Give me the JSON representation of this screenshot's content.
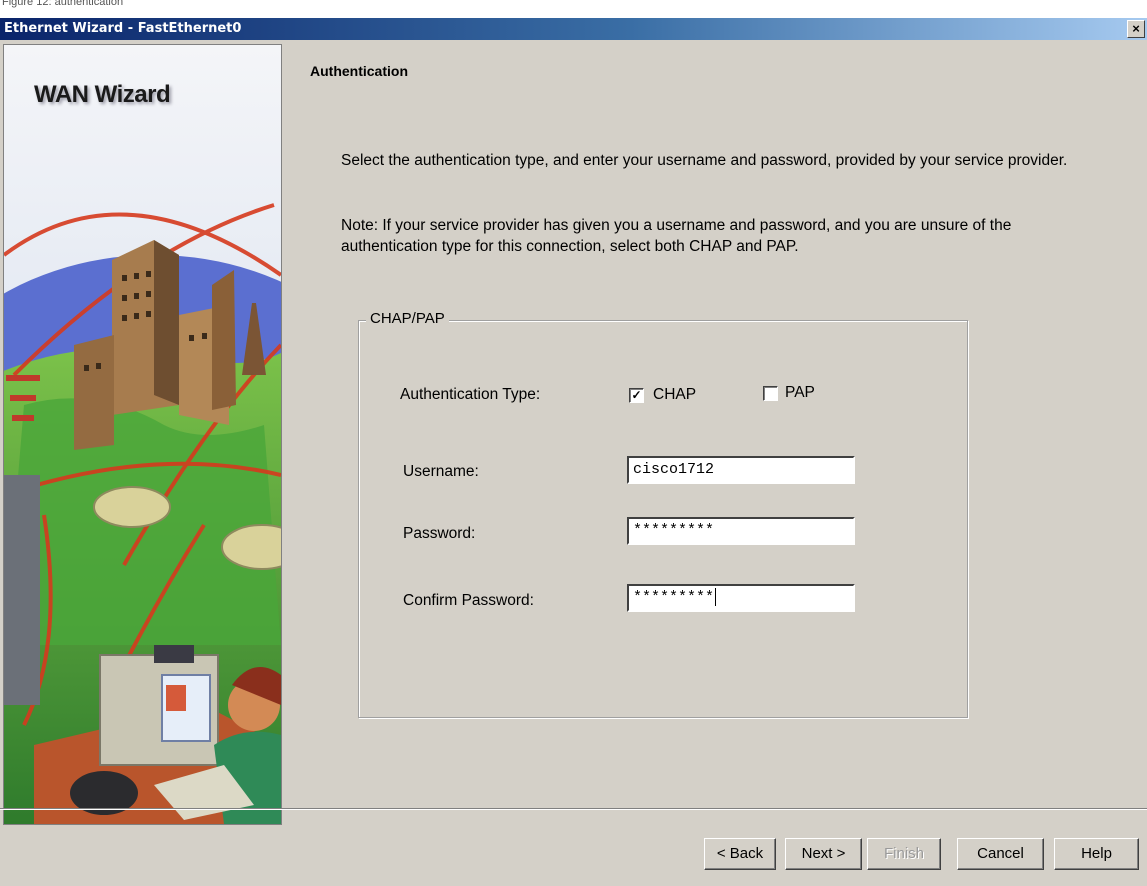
{
  "caption": "Figure 12: authentication",
  "window": {
    "title": "Ethernet Wizard - FastEthernet0",
    "close_label": "×"
  },
  "art": {
    "title": "WAN Wizard"
  },
  "content": {
    "heading": "Authentication",
    "instruction": "Select the authentication type, and enter your username and password, provided by your service provider.",
    "note": "Note: If your service provider has given you a username and password, and you are unsure of the authentication type for this connection, select both CHAP and PAP."
  },
  "group": {
    "legend": "CHAP/PAP",
    "auth_type_label": "Authentication Type:",
    "chap_label": "CHAP",
    "chap_checked": true,
    "pap_label": "PAP",
    "pap_checked": false,
    "username_label": "Username:",
    "username_value": "cisco1712",
    "password_label": "Password:",
    "password_value": "*********",
    "confirm_label": "Confirm Password:",
    "confirm_value": "*********"
  },
  "buttons": {
    "back": "< Back",
    "next": "Next >",
    "finish": "Finish",
    "cancel": "Cancel",
    "help": "Help"
  }
}
